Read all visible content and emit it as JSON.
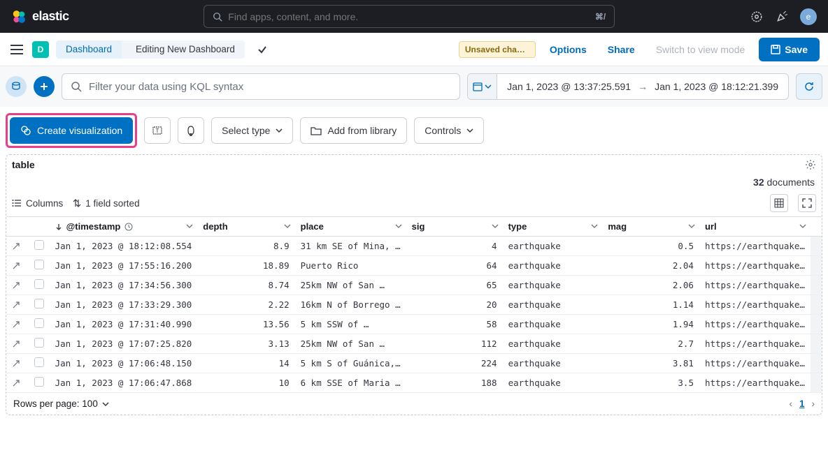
{
  "header": {
    "brand": "elastic",
    "search_placeholder": "Find apps, content, and more.",
    "kbd_hint": "⌘/",
    "avatar_letter": "e"
  },
  "breadcrumb": {
    "badge_letter": "D",
    "crumb1": "Dashboard",
    "crumb2": "Editing New Dashboard",
    "unsaved_badge": "Unsaved chang...",
    "options": "Options",
    "share": "Share",
    "view_mode": "Switch to view mode",
    "save": "Save"
  },
  "filter": {
    "kql_placeholder": "Filter your data using KQL syntax",
    "date_from": "Jan 1, 2023 @ 13:37:25.591",
    "date_to": "Jan 1, 2023 @ 18:12:21.399"
  },
  "toolbar": {
    "create_viz": "Create visualization",
    "select_type": "Select type",
    "add_library": "Add from library",
    "controls": "Controls"
  },
  "panel": {
    "title": "table",
    "doc_count_num": "32",
    "doc_count_label": "documents",
    "columns_label": "Columns",
    "sorted_label": "1 field sorted",
    "rows_per_page": "Rows per page: 100",
    "page_num": "1"
  },
  "columns": [
    "@timestamp",
    "depth",
    "place",
    "sig",
    "type",
    "mag",
    "url"
  ],
  "rows": [
    {
      "ts": "Jan 1, 2023 @ 18:12:08.554",
      "depth": "8.9",
      "place": "31 km SE of Mina, …",
      "sig": "4",
      "type": "earthquake",
      "mag": "0.5",
      "url": "https://earthquake…"
    },
    {
      "ts": "Jan 1, 2023 @ 17:55:16.200",
      "depth": "18.89",
      "place": "Puerto Rico",
      "sig": "64",
      "type": "earthquake",
      "mag": "2.04",
      "url": "https://earthquake…"
    },
    {
      "ts": "Jan 1, 2023 @ 17:34:56.300",
      "depth": "8.74",
      "place": "25km NW of San …",
      "sig": "65",
      "type": "earthquake",
      "mag": "2.06",
      "url": "https://earthquake…"
    },
    {
      "ts": "Jan 1, 2023 @ 17:33:29.300",
      "depth": "2.22",
      "place": "16km N of Borrego …",
      "sig": "20",
      "type": "earthquake",
      "mag": "1.14",
      "url": "https://earthquake…"
    },
    {
      "ts": "Jan 1, 2023 @ 17:31:40.990",
      "depth": "13.56",
      "place": "5 km SSW of …",
      "sig": "58",
      "type": "earthquake",
      "mag": "1.94",
      "url": "https://earthquake…"
    },
    {
      "ts": "Jan 1, 2023 @ 17:07:25.820",
      "depth": "3.13",
      "place": "25km NW of San …",
      "sig": "112",
      "type": "earthquake",
      "mag": "2.7",
      "url": "https://earthquake…"
    },
    {
      "ts": "Jan 1, 2023 @ 17:06:48.150",
      "depth": "14",
      "place": "5 km S of Guánica,…",
      "sig": "224",
      "type": "earthquake",
      "mag": "3.81",
      "url": "https://earthquake…"
    },
    {
      "ts": "Jan 1, 2023 @ 17:06:47.868",
      "depth": "10",
      "place": "6 km SSE of Maria …",
      "sig": "188",
      "type": "earthquake",
      "mag": "3.5",
      "url": "https://earthquake…"
    }
  ]
}
